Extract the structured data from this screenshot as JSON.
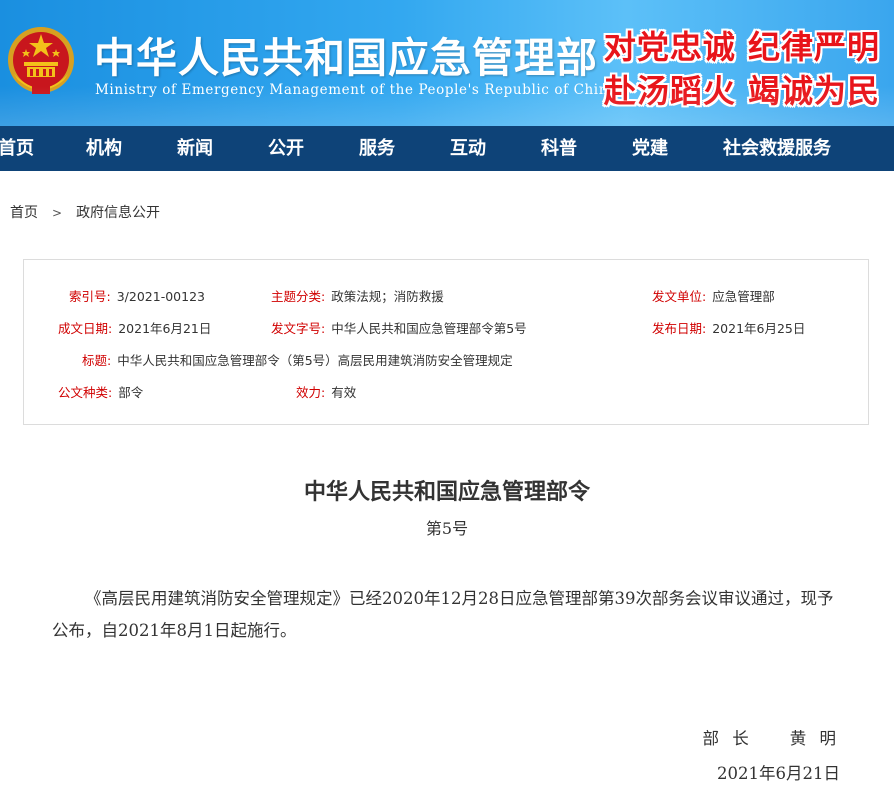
{
  "header": {
    "title": "中华人民共和国应急管理部",
    "subtitle": "Ministry of Emergency Management of the People's Republic of China",
    "slogan_line1": "对党忠诚 纪律严明",
    "slogan_line2": "赴汤蹈火 竭诚为民",
    "emblem_icon": "national-emblem-icon",
    "colors": {
      "banner": "#2a9ee8",
      "slogan": "#e8141a",
      "nav": "#0e4378"
    }
  },
  "nav": {
    "items": [
      {
        "label": "首页"
      },
      {
        "label": "机构"
      },
      {
        "label": "新闻"
      },
      {
        "label": "公开"
      },
      {
        "label": "服务"
      },
      {
        "label": "互动"
      },
      {
        "label": "科普"
      },
      {
        "label": "党建"
      },
      {
        "label": "社会救援服务"
      }
    ]
  },
  "breadcrumb": {
    "home": "首页",
    "separator": ">",
    "current": "政府信息公开"
  },
  "info": {
    "index_label": "索引号:",
    "index_value": "3/2021-00123",
    "topic_label": "主题分类:",
    "topic_value": "政策法规；消防救援",
    "issuer_label": "发文单位:",
    "issuer_value": "应急管理部",
    "created_label": "成文日期:",
    "created_value": "2021年6月21日",
    "docno_label": "发文字号:",
    "docno_value": "中华人民共和国应急管理部令第5号",
    "published_label": "发布日期:",
    "published_value": "2021年6月25日",
    "title_label": "标题:",
    "title_value": "中华人民共和国应急管理部令（第5号）高层民用建筑消防安全管理规定",
    "type_label": "公文种类:",
    "type_value": "部令",
    "validity_label": "效力:",
    "validity_value": "有效"
  },
  "document": {
    "title": "中华人民共和国应急管理部令",
    "number": "第5号",
    "paragraph": "《高层民用建筑消防安全管理规定》已经2020年12月28日应急管理部第39次部务会议审议通过，现予公布，自2021年8月1日起施行。",
    "signer": "部 长    黄 明",
    "date": "2021年6月21日"
  }
}
